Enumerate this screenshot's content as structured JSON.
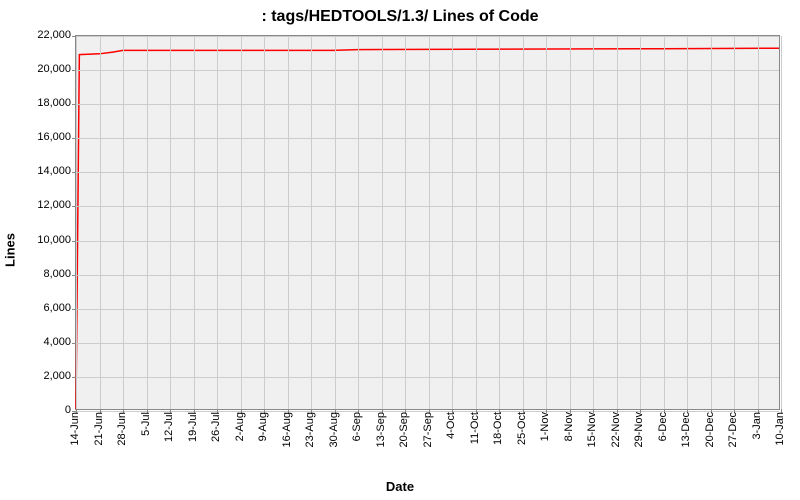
{
  "chart_data": {
    "type": "line",
    "title": ": tags/HEDTOOLS/1.3/ Lines of Code",
    "xlabel": "Date",
    "ylabel": "Lines",
    "ylim": [
      0,
      22000
    ],
    "y_ticks": [
      0,
      2000,
      4000,
      6000,
      8000,
      10000,
      12000,
      14000,
      16000,
      18000,
      20000,
      22000
    ],
    "y_tick_labels": [
      "0",
      "2,000",
      "4,000",
      "6,000",
      "8,000",
      "10,000",
      "12,000",
      "14,000",
      "16,000",
      "18,000",
      "20,000",
      "22,000"
    ],
    "x_tick_labels": [
      "14-Jun",
      "21-Jun",
      "28-Jun",
      "5-Jul",
      "12-Jul",
      "19-Jul",
      "26-Jul",
      "2-Aug",
      "9-Aug",
      "16-Aug",
      "23-Aug",
      "30-Aug",
      "6-Sep",
      "13-Sep",
      "20-Sep",
      "27-Sep",
      "4-Oct",
      "11-Oct",
      "18-Oct",
      "25-Oct",
      "1-Nov",
      "8-Nov",
      "15-Nov",
      "22-Nov",
      "29-Nov",
      "6-Dec",
      "13-Dec",
      "20-Dec",
      "27-Dec",
      "3-Jan",
      "10-Jan"
    ],
    "series": [
      {
        "name": "tags/HEDTOOLS/1.3/",
        "color": "#ff0000",
        "x": [
          "14-Jun",
          "15-Jun",
          "21-Jun",
          "25-Jun",
          "28-Jun",
          "30-Aug",
          "6-Sep",
          "6-Dec",
          "10-Jan"
        ],
        "values": [
          0,
          20900,
          20950,
          21050,
          21150,
          21150,
          21200,
          21250,
          21280
        ]
      }
    ]
  }
}
